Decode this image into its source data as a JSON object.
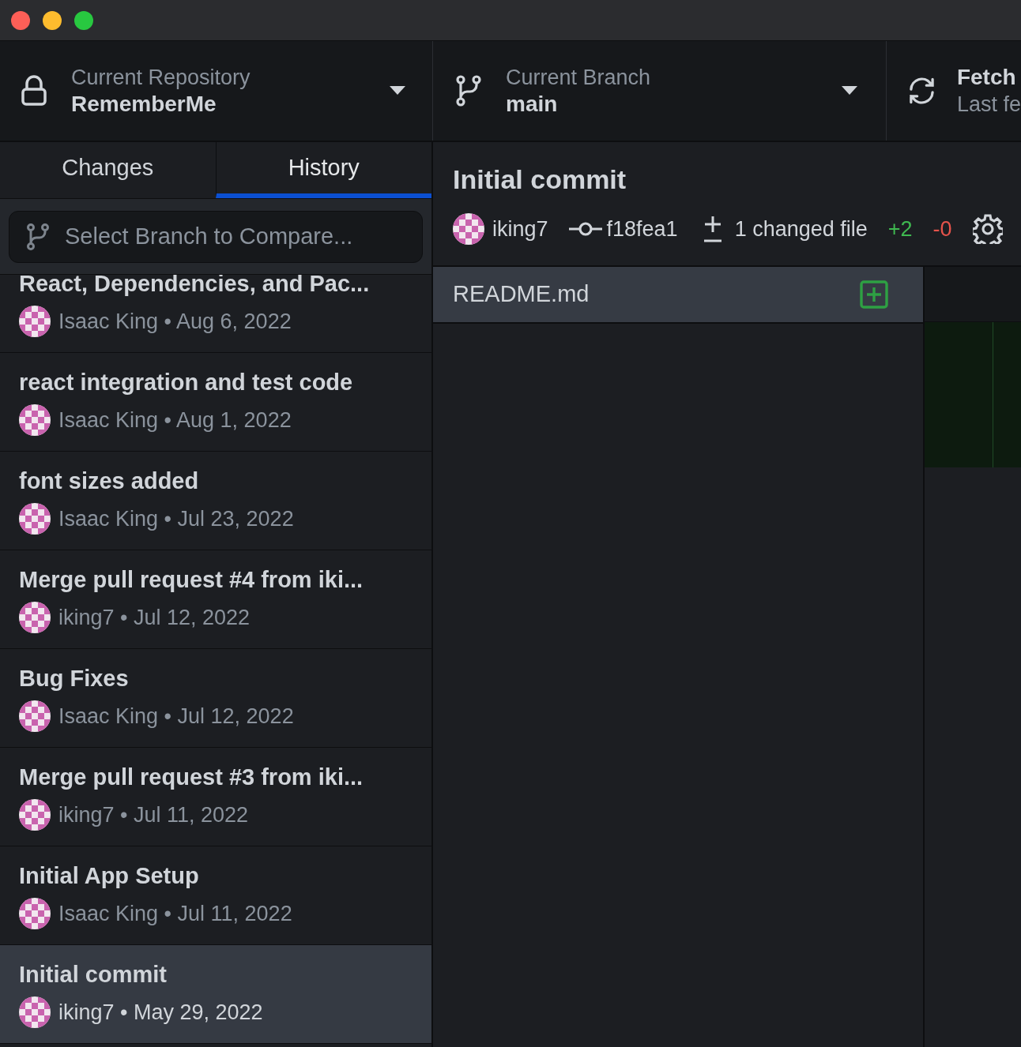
{
  "toolbar": {
    "repository": {
      "label": "Current Repository",
      "value": "RememberMe"
    },
    "branch": {
      "label": "Current Branch",
      "value": "main"
    },
    "fetch": {
      "label": "Fetch",
      "detail": "Last fe"
    }
  },
  "tabs": [
    {
      "label": "Changes",
      "selected": false
    },
    {
      "label": "History",
      "selected": true
    }
  ],
  "branch_filter": {
    "placeholder": "Select Branch to Compare..."
  },
  "commits": [
    {
      "title": "React, Dependencies, and Pac...",
      "byline": "Isaac King • Aug 6, 2022",
      "selected": false
    },
    {
      "title": "react integration and test code",
      "byline": "Isaac King • Aug 1, 2022",
      "selected": false
    },
    {
      "title": "font sizes added",
      "byline": "Isaac King • Jul 23, 2022",
      "selected": false
    },
    {
      "title": "Merge pull request #4 from iki...",
      "byline": "iking7 • Jul 12, 2022",
      "selected": false
    },
    {
      "title": "Bug Fixes",
      "byline": "Isaac King • Jul 12, 2022",
      "selected": false
    },
    {
      "title": "Merge pull request #3 from iki...",
      "byline": "iking7 • Jul 11, 2022",
      "selected": false
    },
    {
      "title": "Initial App Setup",
      "byline": "Isaac King • Jul 11, 2022",
      "selected": false
    },
    {
      "title": "Initial commit",
      "byline": "iking7 • May 29, 2022",
      "selected": true
    }
  ],
  "commit_detail": {
    "title": "Initial commit",
    "author": "iking7",
    "sha": "f18fea1",
    "changed": "1 changed file",
    "additions": "+2",
    "deletions": "-0"
  },
  "files": [
    {
      "name": "README.md",
      "selected": true
    }
  ]
}
